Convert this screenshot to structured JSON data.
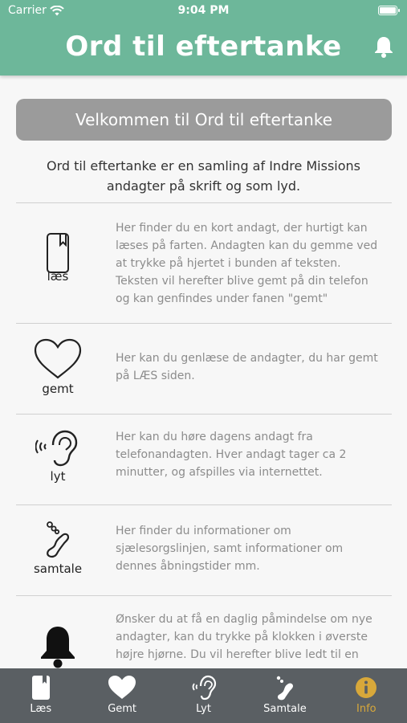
{
  "status": {
    "carrier": "Carrier",
    "time": "9:04 PM"
  },
  "header": {
    "title": "Ord til eftertanke"
  },
  "welcome": "Velkommen til Ord til eftertanke",
  "intro": "Ord til eftertanke er en samling af Indre Missions andagter på skrift og som lyd.",
  "sections": [
    {
      "label": "læs",
      "icon": "book-icon",
      "text": "Her finder du en kort andagt, der hurtigt kan læses på farten. Andagten kan du gemme ved at trykke på hjertet i bunden af teksten. Teksten vil herefter blive gemt på din telefon og kan genfindes under fanen \"gemt\""
    },
    {
      "label": "gemt",
      "icon": "heart-icon",
      "text": "Her kan du genlæse de andagter, du har gemt på LÆS siden."
    },
    {
      "label": "lyt",
      "icon": "ear-icon",
      "text": "Her kan du høre dagens andagt fra telefonandagten. Hver andagt tager ca 2 minutter, og afspilles via internettet."
    },
    {
      "label": "samtale",
      "icon": "phone-icon",
      "text": "Her finder du informationer om sjælesorgslinjen, samt informationer om dennes åbningstider mm."
    },
    {
      "label": "",
      "icon": "bell-icon",
      "text": "Ønsker du at få en daglig påmindelse om nye andagter, kan du trykke på klokken i øverste højre hjørne. Du vil herefter blive ledt til en"
    }
  ],
  "tabs": [
    {
      "label": "Læs",
      "icon": "book-icon",
      "active": false
    },
    {
      "label": "Gemt",
      "icon": "heart-icon",
      "active": false
    },
    {
      "label": "Lyt",
      "icon": "ear-icon",
      "active": false
    },
    {
      "label": "Samtale",
      "icon": "phone-icon",
      "active": false
    },
    {
      "label": "Info",
      "icon": "info-icon",
      "active": true
    }
  ],
  "colors": {
    "header": "#6db79a",
    "tabbar": "#5a5f63",
    "active_tab": "#d8a83a",
    "welcome_bg": "#9b9b9b"
  }
}
